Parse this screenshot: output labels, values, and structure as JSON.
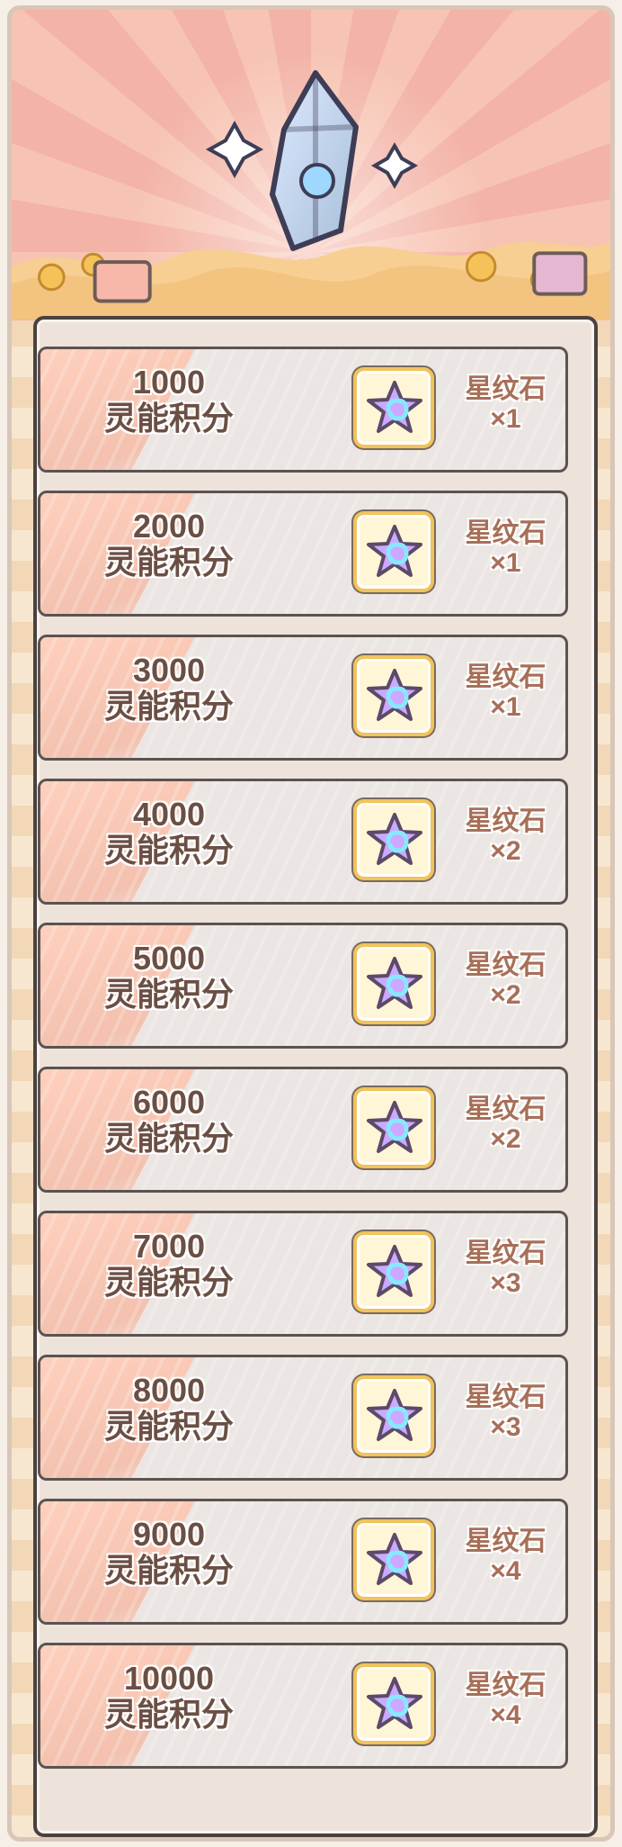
{
  "rewards": [
    {
      "score": "1000",
      "unit": "灵能积分",
      "item_name": "星纹石",
      "quantity": "×1"
    },
    {
      "score": "2000",
      "unit": "灵能积分",
      "item_name": "星纹石",
      "quantity": "×1"
    },
    {
      "score": "3000",
      "unit": "灵能积分",
      "item_name": "星纹石",
      "quantity": "×1"
    },
    {
      "score": "4000",
      "unit": "灵能积分",
      "item_name": "星纹石",
      "quantity": "×2"
    },
    {
      "score": "5000",
      "unit": "灵能积分",
      "item_name": "星纹石",
      "quantity": "×2"
    },
    {
      "score": "6000",
      "unit": "灵能积分",
      "item_name": "星纹石",
      "quantity": "×2"
    },
    {
      "score": "7000",
      "unit": "灵能积分",
      "item_name": "星纹石",
      "quantity": "×3"
    },
    {
      "score": "8000",
      "unit": "灵能积分",
      "item_name": "星纹石",
      "quantity": "×3"
    },
    {
      "score": "9000",
      "unit": "灵能积分",
      "item_name": "星纹石",
      "quantity": "×4"
    },
    {
      "score": "10000",
      "unit": "灵能积分",
      "item_name": "星纹石",
      "quantity": "×4"
    }
  ],
  "icons": {
    "banner": "crystal-treasure-icon",
    "reward": "star-stone-icon"
  },
  "colors": {
    "banner_ray_a": "#f7c4b3",
    "banner_ray_b": "#f3b3a6",
    "panel_border": "#4a4241",
    "card_bg": "#ebe6e3",
    "card_accent": "#f3c1ae",
    "reward_frame": "#f2c35b",
    "star_fill": "#cda8ff"
  }
}
